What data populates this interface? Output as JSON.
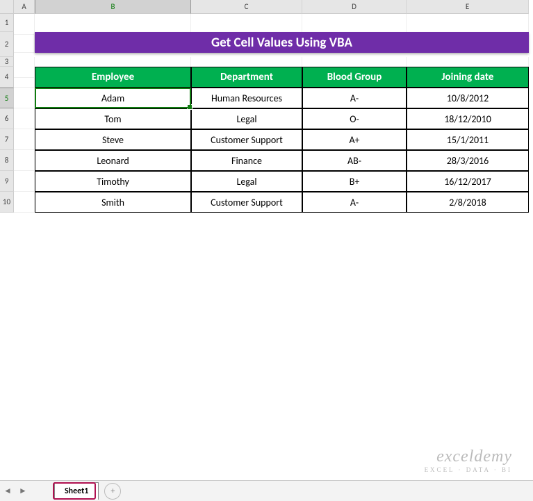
{
  "columns": [
    "A",
    "B",
    "C",
    "D",
    "E"
  ],
  "rows": [
    "1",
    "2",
    "3",
    "4",
    "5",
    "6",
    "7",
    "8",
    "9",
    "10"
  ],
  "active_cell": {
    "row": 5,
    "col": "B"
  },
  "title": "Get Cell Values Using VBA",
  "headers": [
    "Employee",
    "Department",
    "Blood Group",
    "Joining date"
  ],
  "data": [
    {
      "employee": "Adam",
      "department": "Human Resources",
      "blood": "A-",
      "date": "10/8/2012"
    },
    {
      "employee": "Tom",
      "department": "Legal",
      "blood": "O-",
      "date": "18/12/2010"
    },
    {
      "employee": "Steve",
      "department": "Customer Support",
      "blood": "A+",
      "date": "15/1/2011"
    },
    {
      "employee": "Leonard",
      "department": "Finance",
      "blood": "AB-",
      "date": "28/3/2016"
    },
    {
      "employee": "Timothy",
      "department": "Legal",
      "blood": "B+",
      "date": "16/12/2017"
    },
    {
      "employee": "Smith",
      "department": "Customer Support",
      "blood": "A-",
      "date": "2/8/2018"
    }
  ],
  "sheet_tab": "Sheet1",
  "add_sheet_label": "+",
  "nav_prev": "◄",
  "nav_next": "►",
  "watermark": {
    "brand": "exceldemy",
    "sub": "EXCEL · DATA · BI"
  }
}
